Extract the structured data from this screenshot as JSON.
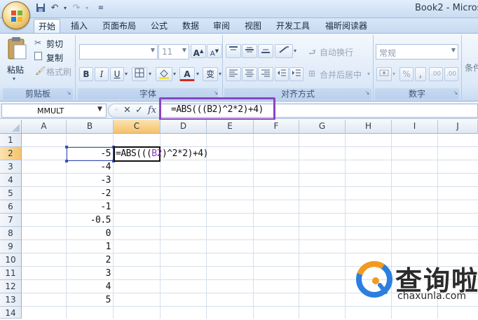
{
  "window": {
    "title": "Book2 - Micros"
  },
  "ribbon": {
    "tabs": [
      "开始",
      "插入",
      "页面布局",
      "公式",
      "数据",
      "审阅",
      "视图",
      "开发工具",
      "福昕阅读器"
    ],
    "active_tab": "开始",
    "clipboard": {
      "paste": "粘贴",
      "cut": "剪切",
      "copy": "复制",
      "format_painter": "格式刷",
      "label": "剪贴板"
    },
    "font": {
      "name_value": "",
      "size_value": "11",
      "grow": "A",
      "shrink": "A",
      "bold": "B",
      "italic": "I",
      "underline": "U",
      "font_color": "A",
      "phonetic": "变",
      "label": "字体"
    },
    "alignment": {
      "wrap_text": "自动换行",
      "merge_center": "合并后居中",
      "label": "对齐方式"
    },
    "number": {
      "format_value": "常规",
      "percent": "%",
      "comma": ",",
      "decimal": ".00",
      "label": "数字"
    },
    "styles": {
      "conditional_format": "条件"
    }
  },
  "formula_bar": {
    "name_box": "MMULT",
    "cancel": "✕",
    "enter": "✓",
    "fx": "fx",
    "formula": "=ABS(((B2)^2*2)+4)"
  },
  "sheet": {
    "columns": [
      "A",
      "B",
      "C",
      "D",
      "E",
      "F",
      "G",
      "H",
      "I",
      "J"
    ],
    "rows": [
      "1",
      "2",
      "3",
      "4",
      "5",
      "6",
      "7",
      "8",
      "9",
      "10",
      "11",
      "12",
      "13",
      "14"
    ],
    "active_column": "C",
    "active_row": "2",
    "column_b_values": [
      "-5",
      "-4",
      "-3",
      "-2",
      "-1",
      "-0.5",
      "0",
      "1",
      "2",
      "3",
      "4",
      "5"
    ],
    "editing": {
      "part1": "=ABS(((",
      "ref": "B2",
      "part2": ")^2*2)+4)"
    }
  },
  "watermark": {
    "text": "查询啦",
    "url": "chaxunla.com"
  },
  "colors": {
    "highlight": "#8a44c4",
    "ref": "#3b4fb8",
    "active_header": "#f5c26b"
  }
}
